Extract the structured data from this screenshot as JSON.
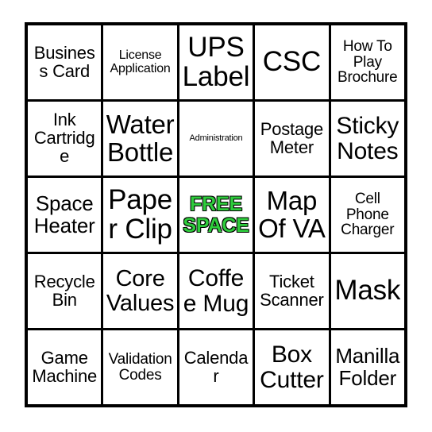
{
  "card": {
    "type": "bingo-card",
    "rows": 5,
    "columns": 5,
    "border_color": "#000000",
    "background_color": "#ffffff",
    "free_space_color": "#2ecc3c",
    "free_space_outline_color": "#000000",
    "cells": [
      {
        "id": "r1c1",
        "text": "Business Card",
        "size": "m",
        "free": false
      },
      {
        "id": "r1c2",
        "text": "License Application",
        "size": "xs",
        "free": false
      },
      {
        "id": "r1c3",
        "text": "UPS Label",
        "size": "xxl",
        "free": false
      },
      {
        "id": "r1c4",
        "text": "CSC",
        "size": "xxl",
        "free": false
      },
      {
        "id": "r1c5",
        "text": "How To Play Brochure",
        "size": "s",
        "free": false
      },
      {
        "id": "r2c1",
        "text": "Ink Cartridge",
        "size": "m",
        "free": false
      },
      {
        "id": "r2c2",
        "text": "Water Bottle",
        "size": "xxl",
        "free": false
      },
      {
        "id": "r2c3",
        "text": "Administration",
        "size": "tiny",
        "free": false
      },
      {
        "id": "r2c4",
        "text": "Postage Meter",
        "size": "m",
        "free": false
      },
      {
        "id": "r2c5",
        "text": "Sticky Notes",
        "size": "xl",
        "free": false
      },
      {
        "id": "r3c1",
        "text": "Space Heater",
        "size": "l",
        "free": false
      },
      {
        "id": "r3c2",
        "text": "Paper Clip",
        "size": "xxl",
        "free": false
      },
      {
        "id": "r3c3",
        "text": "FREE SPACE",
        "size": "l",
        "free": true
      },
      {
        "id": "r3c4",
        "text": "Map Of VA",
        "size": "xxl",
        "free": false
      },
      {
        "id": "r3c5",
        "text": "Cell Phone Charger",
        "size": "s",
        "free": false
      },
      {
        "id": "r4c1",
        "text": "Recycle Bin",
        "size": "m",
        "free": false
      },
      {
        "id": "r4c2",
        "text": "Core Values",
        "size": "xl",
        "free": false
      },
      {
        "id": "r4c3",
        "text": "Coffee Mug",
        "size": "xl",
        "free": false
      },
      {
        "id": "r4c4",
        "text": "Ticket Scanner",
        "size": "m",
        "free": false
      },
      {
        "id": "r4c5",
        "text": "Mask",
        "size": "xxl",
        "free": false
      },
      {
        "id": "r5c1",
        "text": "Game Machine",
        "size": "m",
        "free": false
      },
      {
        "id": "r5c2",
        "text": "Validation Codes",
        "size": "s",
        "free": false
      },
      {
        "id": "r5c3",
        "text": "Calendar",
        "size": "m",
        "free": false
      },
      {
        "id": "r5c4",
        "text": "Box Cutter",
        "size": "xl",
        "free": false
      },
      {
        "id": "r5c5",
        "text": "Manilla Folder",
        "size": "l",
        "free": false
      }
    ]
  }
}
